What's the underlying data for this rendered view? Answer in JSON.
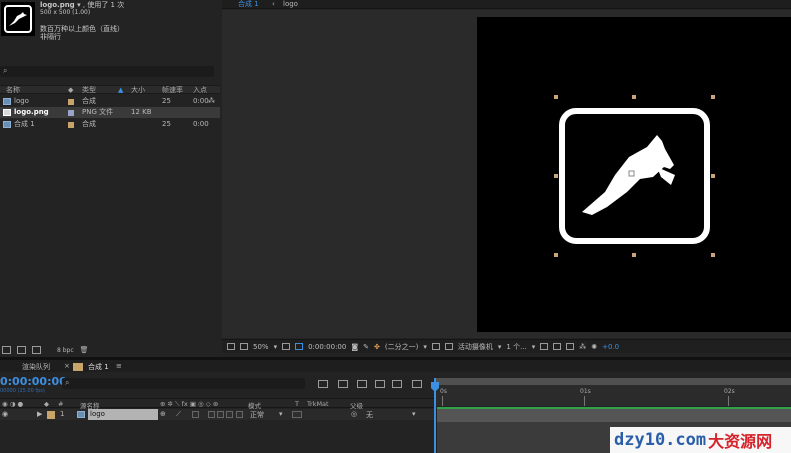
{
  "project": {
    "file_name": "logo.png",
    "usage": "▾ , 使用了 1 次",
    "dimensions": "500 x 500 (1.00)",
    "color_info": "数百万种以上颜色（直线）",
    "interlace": "非隔行",
    "search_placeholder": "",
    "columns": {
      "name": "名称",
      "type": "类型",
      "size": "大小",
      "fps": "帧速率",
      "in": "入点"
    },
    "items": [
      {
        "name": "logo",
        "type": "合成",
        "size": "",
        "fps": "25",
        "in": "0:00",
        "label_color": "#c9a46a"
      },
      {
        "name": "logo.png",
        "type": "PNG 文件",
        "size": "12 KB",
        "fps": "",
        "in": "",
        "label_color": "#9aa4c9"
      },
      {
        "name": "合成 1",
        "type": "合成",
        "size": "",
        "fps": "25",
        "in": "0:00",
        "label_color": "#c9a46a"
      }
    ],
    "bpc": "8 bpc"
  },
  "viewer": {
    "tabs": [
      "合成 1",
      "logo"
    ],
    "zoom": "50%",
    "timecode": "0:00:00:00",
    "resolution": "(二分之一)",
    "camera": "活动摄像机",
    "views": "1 个...",
    "exposure": "+0.0"
  },
  "timeline": {
    "tabs": [
      "渲染队列",
      "合成 1"
    ],
    "menu_icon": "≡",
    "timecode": "0:00:00:00",
    "fps_label": "00000 (25.00 fps)",
    "columns": {
      "name": "源名称",
      "mode": "模式",
      "trkmat": "TrkMat",
      "parent": "父级",
      "hash": "#",
      "t": "T"
    },
    "layer": {
      "index": "1",
      "name": "logo",
      "mode": "正常",
      "parent": "无"
    },
    "ruler": [
      "0s",
      "01s",
      "02s"
    ]
  },
  "watermark": {
    "text1": "dzy10.com",
    "text2": "大资源网"
  },
  "colors": {
    "accent": "#3d8fe0",
    "layer_bar_top": "#2fa348",
    "handle": "#c8a678"
  }
}
